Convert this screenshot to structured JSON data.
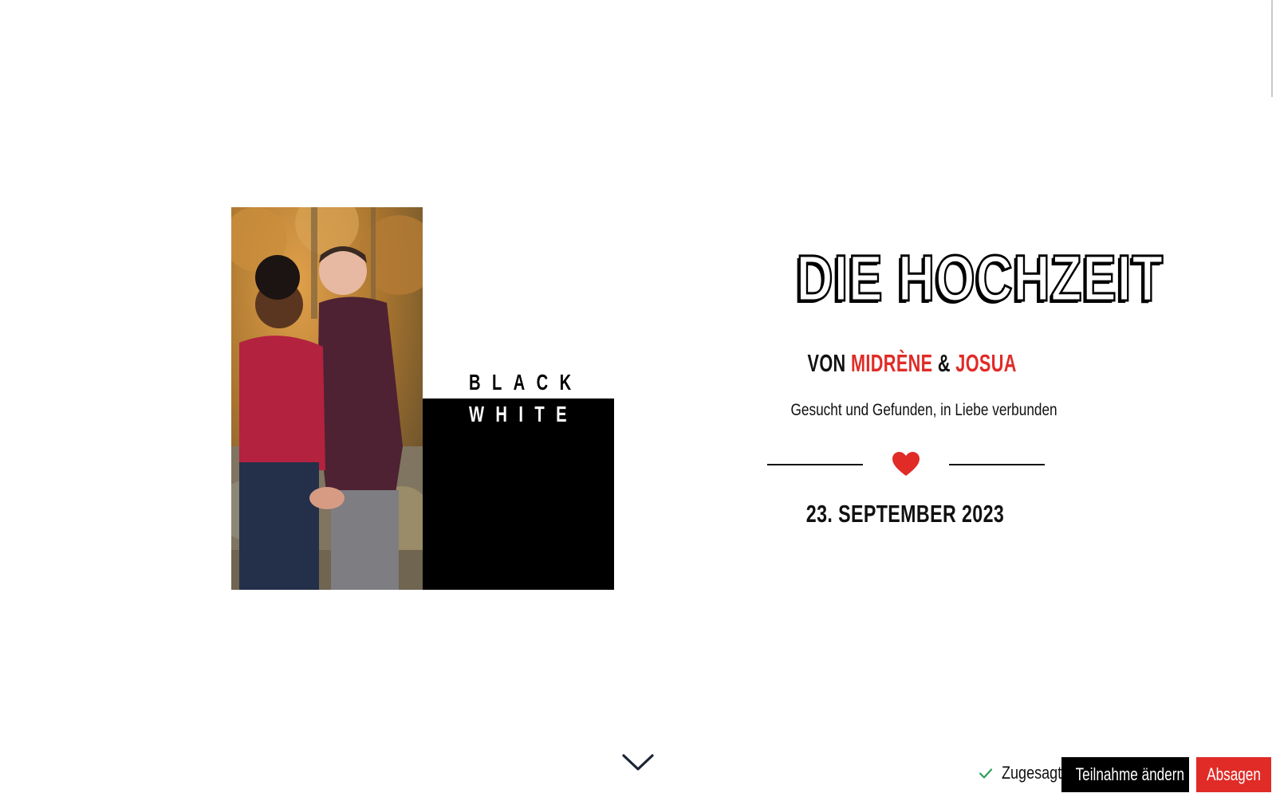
{
  "hero": {
    "photo_alt": "",
    "black_word": "BLACK",
    "white_word": "WHITE"
  },
  "invitation": {
    "title": "DIE HOCHZEIT",
    "names_prefix": "VON",
    "name_one": "MIDRÈNE",
    "names_joiner": "&",
    "name_two": "JOSUA",
    "tagline": "Gesucht und Gefunden, in Liebe verbunden",
    "divider_icon": "heart-icon",
    "date": "23. SEPTEMBER 2023"
  },
  "navigation": {
    "scroll_icon": "chevron-down-icon"
  },
  "rsvp": {
    "status_icon": "check-icon",
    "status_label": "Zugesagt",
    "change_label": "Teilnahme ändern",
    "decline_label": "Absagen"
  },
  "colors": {
    "accent_red": "#e02b27",
    "black": "#000000",
    "status_green": "#2e9e5a"
  }
}
